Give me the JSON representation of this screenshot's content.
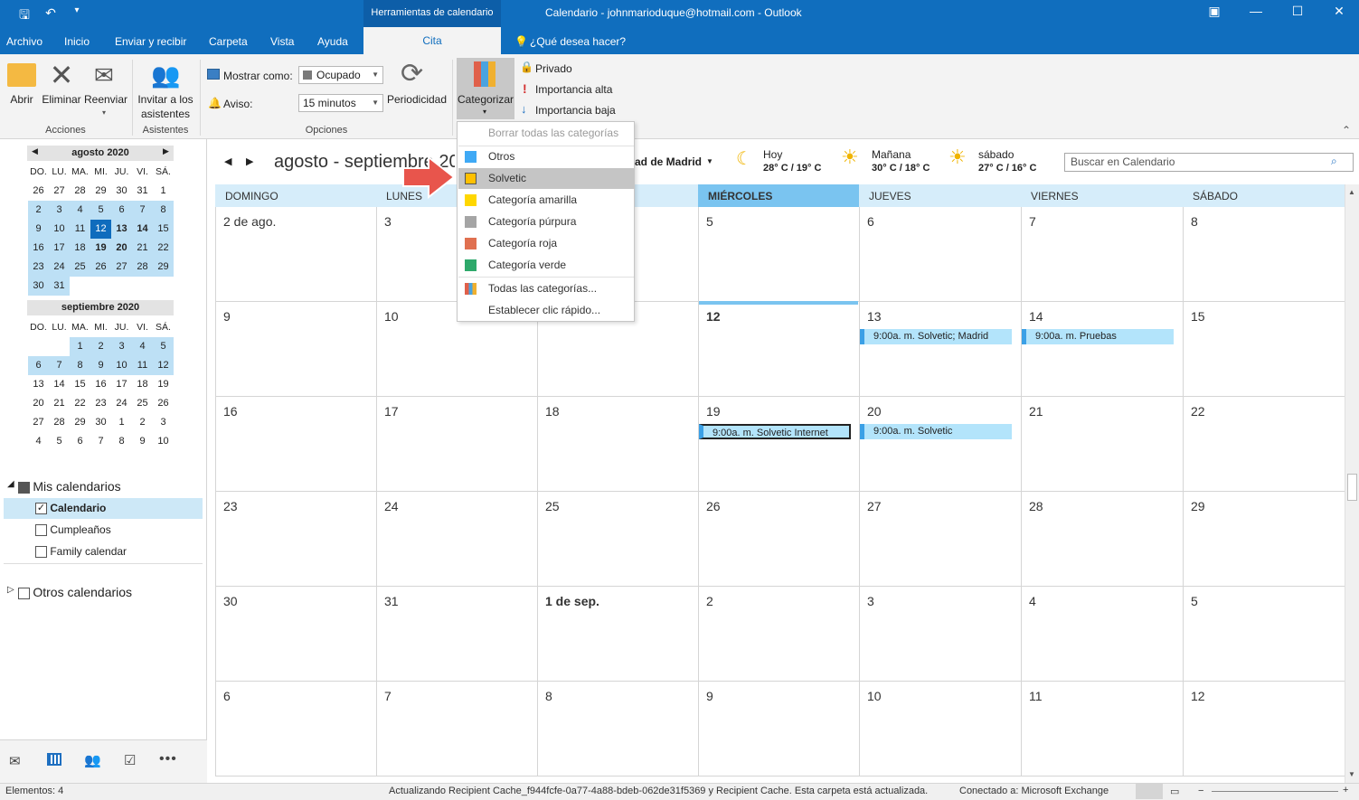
{
  "titlebar": {
    "context_tools": "Herramientas de calendario",
    "window_title": "Calendario - johnmarioduque@hotmail.com  -  Outlook"
  },
  "menu": [
    "Archivo",
    "Inicio",
    "Enviar y recibir",
    "Carpeta",
    "Vista",
    "Ayuda"
  ],
  "active_tab": "Cita",
  "tell_me": "¿Qué desea hacer?",
  "ribbon": {
    "abrir": "Abrir",
    "eliminar": "Eliminar",
    "reenviar": "Reenviar",
    "acciones": "Acciones",
    "invitar1": "Invitar a los",
    "invitar2": "asistentes",
    "asistentes": "Asistentes",
    "mostrar_como_label": "Mostrar como:",
    "mostrar_como_value": "Ocupado",
    "aviso_label": "Aviso:",
    "aviso_value": "15 minutos",
    "periodicidad": "Periodicidad",
    "opciones": "Opciones",
    "categorizar": "Categorizar",
    "privado": "Privado",
    "importancia_alta": "Importancia alta",
    "importancia_baja": "Importancia baja"
  },
  "mini_calendars": [
    {
      "title": "agosto 2020",
      "dow": [
        "DO.",
        "LU.",
        "MA.",
        "MI.",
        "JU.",
        "VI.",
        "SÁ."
      ],
      "weeks": [
        [
          "26",
          "27",
          "28",
          "29",
          "30",
          "31",
          "1"
        ],
        [
          "2",
          "3",
          "4",
          "5",
          "6",
          "7",
          "8"
        ],
        [
          "9",
          "10",
          "11",
          "12",
          "13",
          "14",
          "15"
        ],
        [
          "16",
          "17",
          "18",
          "19",
          "20",
          "21",
          "22"
        ],
        [
          "23",
          "24",
          "25",
          "26",
          "27",
          "28",
          "29"
        ],
        [
          "30",
          "31",
          "",
          "",
          "",
          "",
          ""
        ]
      ]
    },
    {
      "title": "septiembre 2020",
      "dow": [
        "DO.",
        "LU.",
        "MA.",
        "MI.",
        "JU.",
        "VI.",
        "SÁ."
      ],
      "weeks": [
        [
          "",
          "",
          "1",
          "2",
          "3",
          "4",
          "5"
        ],
        [
          "6",
          "7",
          "8",
          "9",
          "10",
          "11",
          "12"
        ],
        [
          "13",
          "14",
          "15",
          "16",
          "17",
          "18",
          "19"
        ],
        [
          "20",
          "21",
          "22",
          "23",
          "24",
          "25",
          "26"
        ],
        [
          "27",
          "28",
          "29",
          "30",
          "1",
          "2",
          "3"
        ],
        [
          "4",
          "5",
          "6",
          "7",
          "8",
          "9",
          "10"
        ]
      ]
    }
  ],
  "folders": {
    "mis_calendarios": "Mis calendarios",
    "items": [
      "Calendario",
      "Cumpleaños",
      "Family calendar"
    ],
    "otros": "Otros calendarios"
  },
  "calendar_header": {
    "range": "agosto - septiembre 20",
    "location": "ad de Madrid",
    "weather": [
      {
        "day": "Hoy",
        "temp": "28° C / 19° C",
        "icon": "moon-icon"
      },
      {
        "day": "Mañana",
        "temp": "30° C / 18° C",
        "icon": "sun-icon"
      },
      {
        "day": "sábado",
        "temp": "27° C / 16° C",
        "icon": "sun-icon"
      }
    ],
    "search_placeholder": "Buscar en Calendario"
  },
  "day_names": [
    "DOMINGO",
    "LUNES",
    "",
    "MIÉRCOLES",
    "JUEVES",
    "VIERNES",
    "SÁBADO"
  ],
  "weeks": [
    [
      "2 de ago.",
      "3",
      "",
      "5",
      "6",
      "7",
      "8"
    ],
    [
      "9",
      "10",
      "",
      "12",
      "13",
      "14",
      "15"
    ],
    [
      "16",
      "17",
      "18",
      "19",
      "20",
      "21",
      "22"
    ],
    [
      "23",
      "24",
      "25",
      "26",
      "27",
      "28",
      "29"
    ],
    [
      "30",
      "31",
      "1 de sep.",
      "2",
      "3",
      "4",
      "5"
    ],
    [
      "6",
      "7",
      "8",
      "9",
      "10",
      "11",
      "12"
    ]
  ],
  "events": {
    "e1": "9:00a. m. Solvetic; Madrid",
    "e2": "9:00a. m. Pruebas",
    "e3": "9:00a. m. Solvetic Internet",
    "e4": "9:00a. m. Solvetic"
  },
  "category_menu": {
    "clear": "Borrar todas las categorías",
    "items": [
      {
        "label": "Otros",
        "color": "#3fa9f5"
      },
      {
        "label": "Solvetic",
        "color": "#ffc000"
      },
      {
        "label": "Categoría amarilla",
        "color": "#ffd700"
      },
      {
        "label": "Categoría púrpura",
        "color": "#a5a5a5"
      },
      {
        "label": "Categoría roja",
        "color": "#e07050"
      },
      {
        "label": "Categoría verde",
        "color": "#2ea96b"
      }
    ],
    "all": "Todas las categorías...",
    "quick": "Establecer clic rápido..."
  },
  "status": {
    "items": "Elementos: 4",
    "updating": "Actualizando Recipient Cache_f944fcfe-0a77-4a88-bdeb-062de31f5369 y Recipient Cache.  Esta carpeta está actualizada.",
    "connected": "Conectado a: Microsoft Exchange"
  }
}
